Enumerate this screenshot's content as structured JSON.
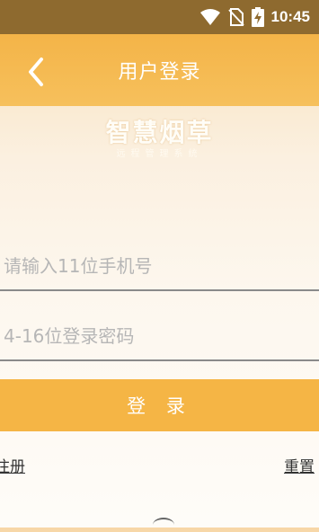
{
  "status_bar": {
    "time": "10:45",
    "icons": [
      "wifi-icon",
      "no-sim-icon",
      "battery-charging-icon"
    ]
  },
  "header": {
    "title": "用户登录",
    "back_icon": "chevron-left-icon"
  },
  "logo": {
    "title": "智慧烟草",
    "subtitle": "远程管理系统"
  },
  "form": {
    "phone_placeholder": "请输入11位手机号",
    "password_placeholder": "4-16位登录密码",
    "login_label": "登 录"
  },
  "links": {
    "register": "注册",
    "reset": "重置"
  },
  "colors": {
    "status_bar": "#8e6a2f",
    "accent": "#f5b545"
  }
}
